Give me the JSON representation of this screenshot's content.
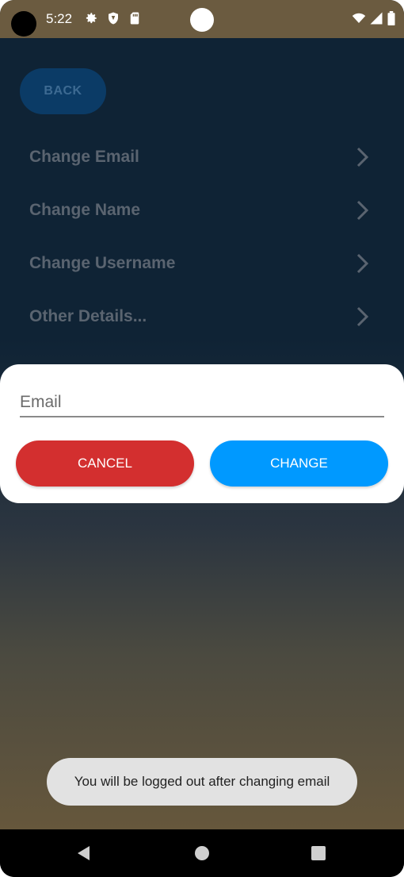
{
  "status_bar": {
    "time": "5:22",
    "icons": [
      "settings-icon",
      "shield-icon",
      "sim-card-icon",
      "wifi-icon",
      "signal-icon",
      "battery-icon"
    ]
  },
  "settings": {
    "back_label": "BACK",
    "menu_items": [
      {
        "label": "Change Email"
      },
      {
        "label": "Change Name"
      },
      {
        "label": "Change Username"
      },
      {
        "label": "Other Details..."
      }
    ]
  },
  "dialog": {
    "email_placeholder": "Email",
    "email_value": "",
    "cancel_label": "CANCEL",
    "change_label": "CHANGE"
  },
  "toast": {
    "message": "You will be logged out after changing email"
  },
  "colors": {
    "cancel": "#d32f2f",
    "change": "#0099ff",
    "statusbar": "#6b5b40",
    "background_top": "#0f2335",
    "background_bottom": "#66573c"
  },
  "nav_bar": {
    "icons": [
      "back-triangle-icon",
      "home-circle-icon",
      "recents-square-icon"
    ]
  }
}
